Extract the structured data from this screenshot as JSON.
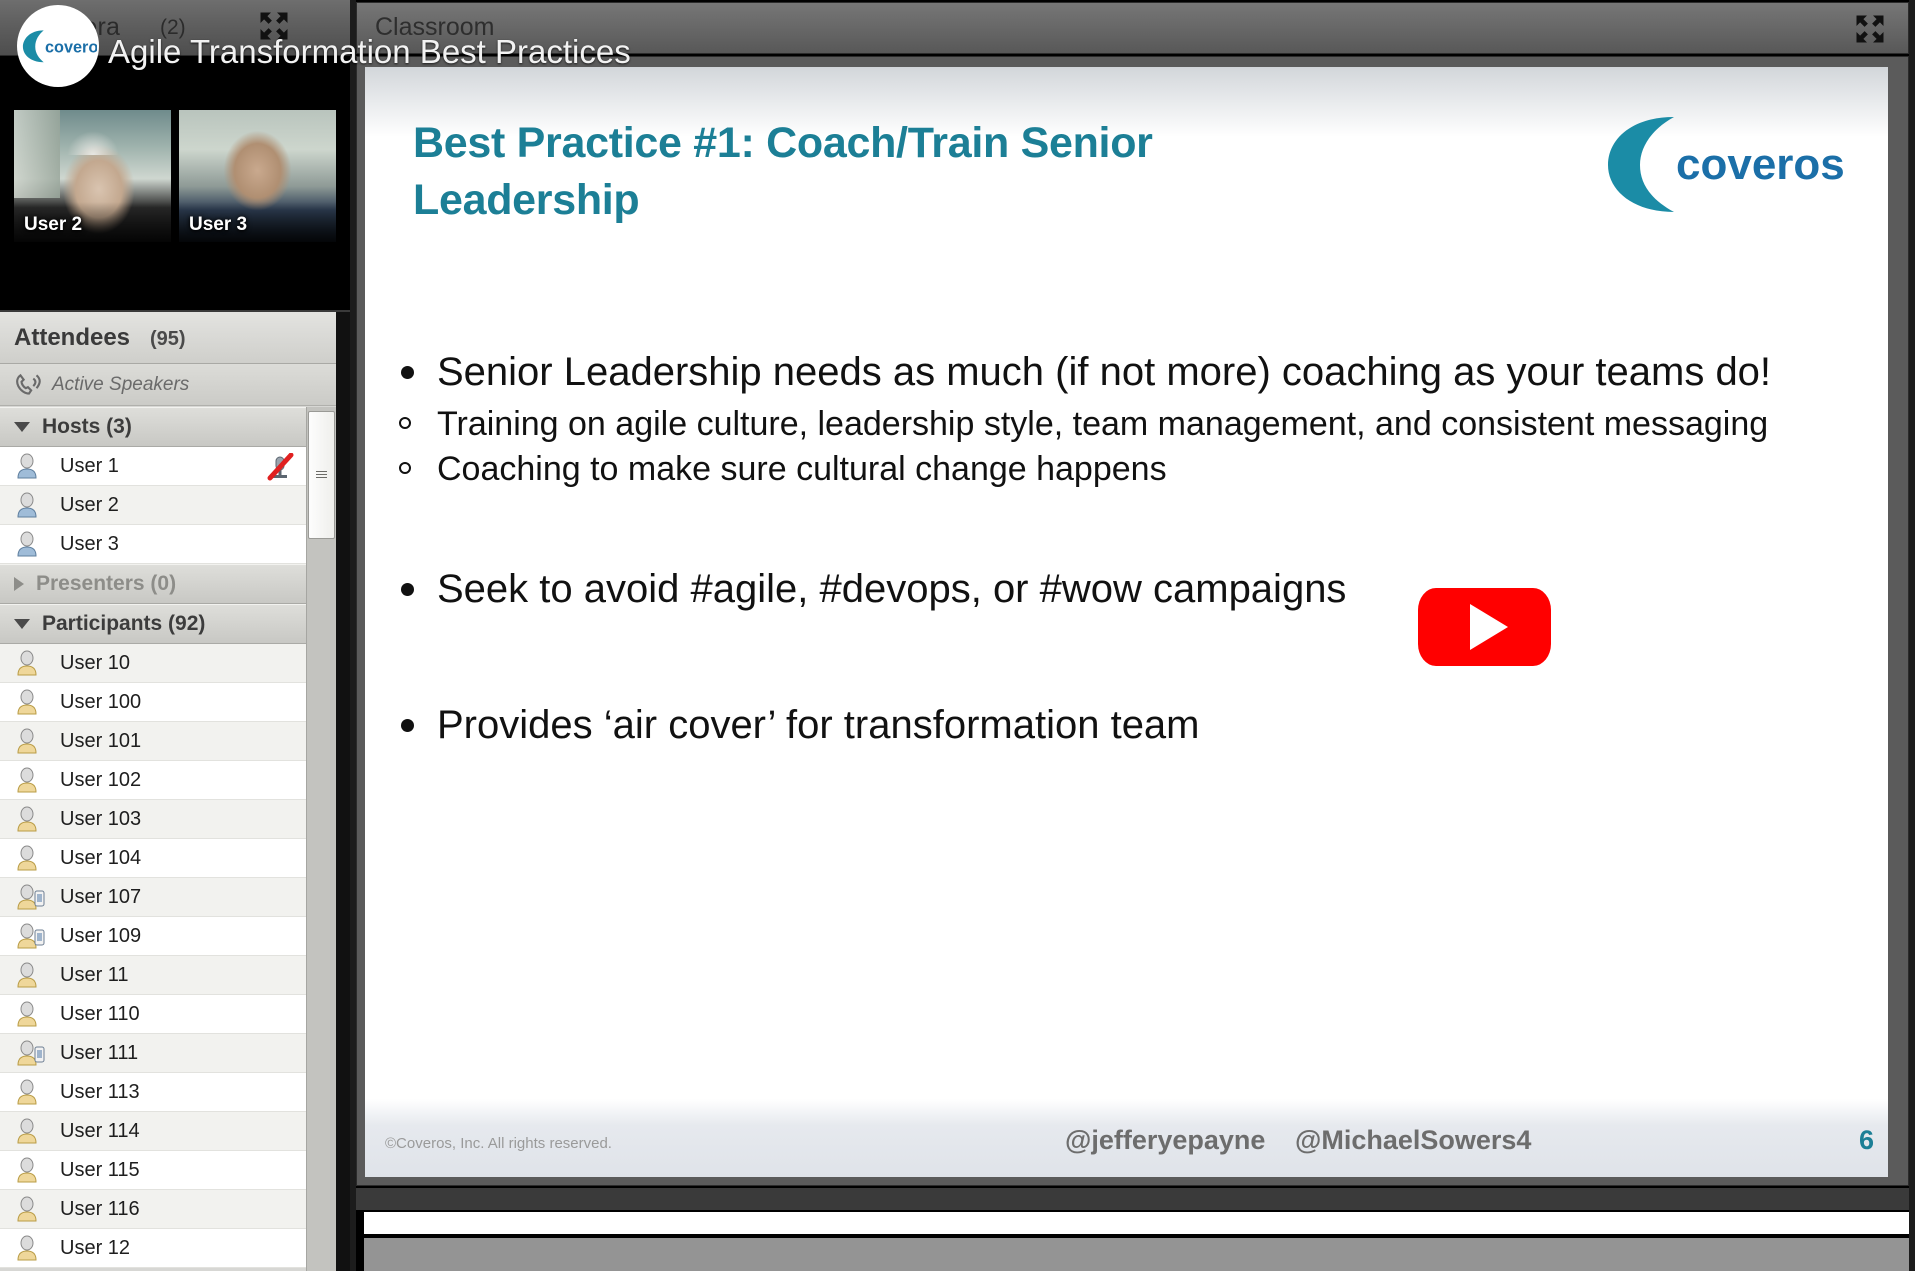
{
  "camera": {
    "title": "Camera",
    "count": "(2)",
    "expand_icon": "fullscreen-icon",
    "tiles": [
      {
        "name": "User 2"
      },
      {
        "name": "User 3"
      }
    ]
  },
  "overlay": {
    "title": "Agile Transformation Best Practices",
    "logo_text": "coveros"
  },
  "attendees": {
    "title": "Attendees",
    "count": "(95)",
    "active_speakers_label": "Active Speakers",
    "phone_icon": "phone-icon",
    "groups": [
      {
        "label": "Hosts (3)",
        "expanded": true,
        "members": [
          {
            "name": "User 1",
            "icon": "host-person-icon",
            "muted": true
          },
          {
            "name": "User 2",
            "icon": "host-person-icon",
            "muted": false
          },
          {
            "name": "User 3",
            "icon": "host-person-icon",
            "muted": false
          }
        ]
      },
      {
        "label": "Presenters (0)",
        "expanded": false,
        "members": []
      },
      {
        "label": "Participants (92)",
        "expanded": true,
        "members": [
          {
            "name": "User 10",
            "icon": "person-icon",
            "muted": false
          },
          {
            "name": "User 100",
            "icon": "person-icon",
            "muted": false
          },
          {
            "name": "User 101",
            "icon": "person-icon",
            "muted": false
          },
          {
            "name": "User 102",
            "icon": "person-icon",
            "muted": false
          },
          {
            "name": "User 103",
            "icon": "person-icon",
            "muted": false
          },
          {
            "name": "User 104",
            "icon": "person-icon",
            "muted": false
          },
          {
            "name": "User 107",
            "icon": "person-phone-icon",
            "muted": false
          },
          {
            "name": "User 109",
            "icon": "person-phone-icon",
            "muted": false
          },
          {
            "name": "User 11",
            "icon": "person-icon",
            "muted": false
          },
          {
            "name": "User 110",
            "icon": "person-icon",
            "muted": false
          },
          {
            "name": "User 111",
            "icon": "person-phone-icon",
            "muted": false
          },
          {
            "name": "User 113",
            "icon": "person-icon",
            "muted": false
          },
          {
            "name": "User 114",
            "icon": "person-icon",
            "muted": false
          },
          {
            "name": "User 115",
            "icon": "person-icon",
            "muted": false
          },
          {
            "name": "User 116",
            "icon": "person-icon",
            "muted": false
          },
          {
            "name": "User 12",
            "icon": "person-icon",
            "muted": false
          }
        ]
      }
    ]
  },
  "slide_pane": {
    "header_title": "Classroom",
    "expand_icon": "fullscreen-icon"
  },
  "slide": {
    "title": "Best Practice #1: Coach/Train Senior Leadership",
    "logo_text": "coveros",
    "bullets": [
      {
        "text": "Senior Leadership needs as much (if not more) coaching as your teams do!",
        "children": [
          "Training on agile culture, leadership style, team management, and consistent messaging",
          "Coaching to make sure cultural change happens"
        ]
      },
      {
        "text": "Seek to avoid #agile, #devops, or #wow campaigns",
        "children": []
      },
      {
        "text": "Provides ‘air cover’ for transformation team",
        "children": []
      }
    ],
    "footer": {
      "copyright": "©Coveros, Inc. All rights reserved.",
      "handle_1": "@jefferyepayne",
      "handle_2": "@MichaelSowers4",
      "page_number": "6"
    }
  },
  "player": {
    "play_icon": "youtube-play-icon",
    "accent_color": "#ff0000"
  },
  "colors": {
    "brand_teal": "#1c7f96",
    "panel_gray": "#d7d7d4"
  }
}
